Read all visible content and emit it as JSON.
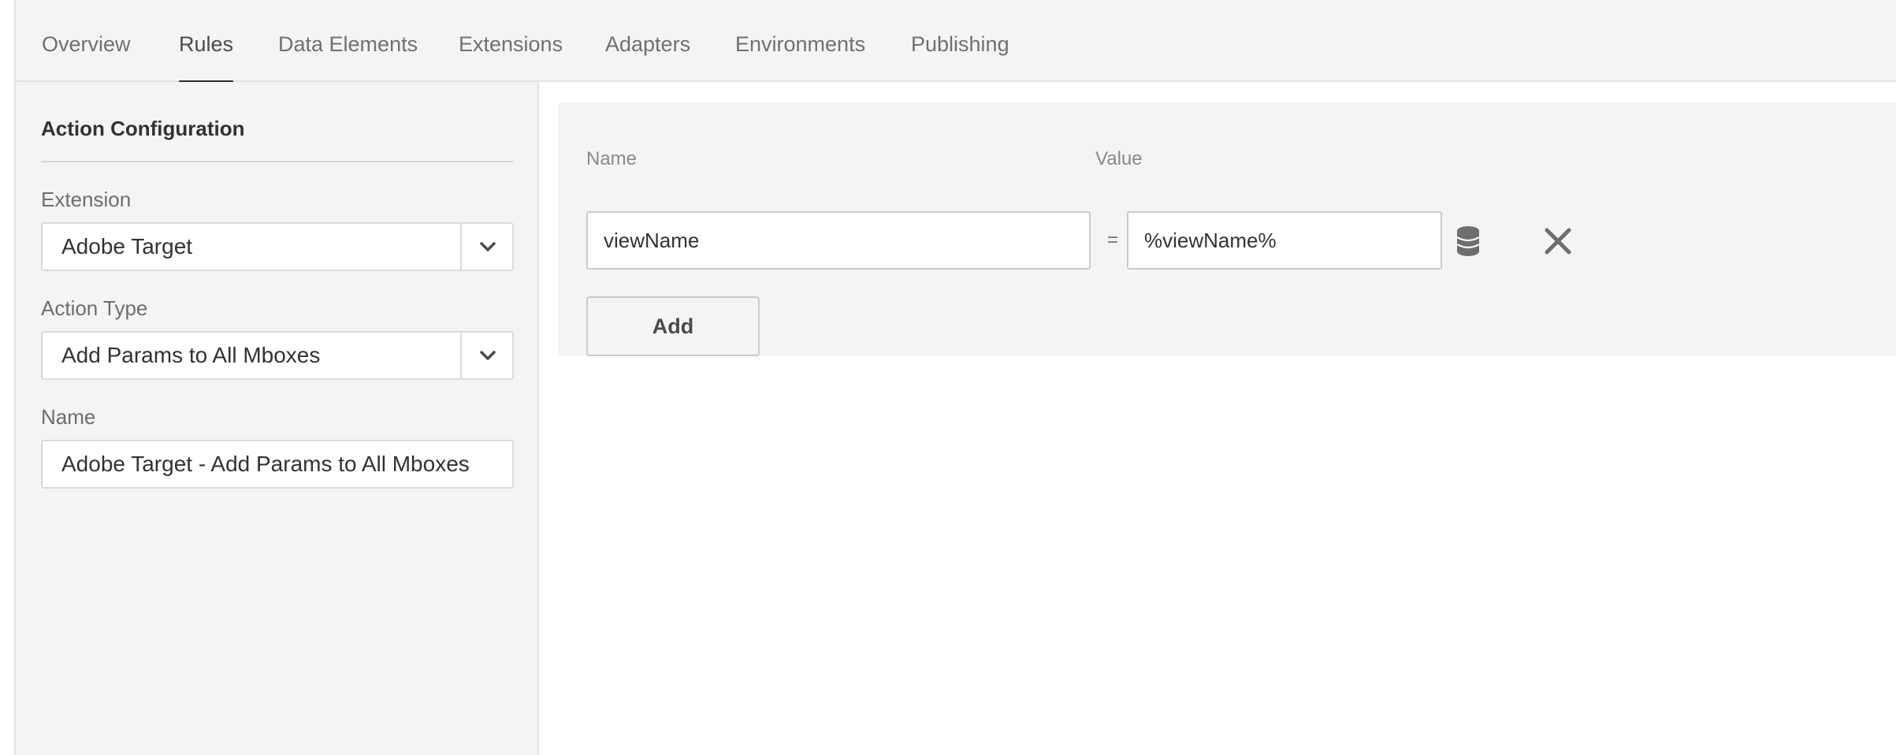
{
  "nav": {
    "tabs": [
      {
        "label": "Overview",
        "active": false
      },
      {
        "label": "Rules",
        "active": true
      },
      {
        "label": "Data Elements",
        "active": false
      },
      {
        "label": "Extensions",
        "active": false
      },
      {
        "label": "Adapters",
        "active": false
      },
      {
        "label": "Environments",
        "active": false
      },
      {
        "label": "Publishing",
        "active": false
      }
    ]
  },
  "sidebar": {
    "title": "Action Configuration",
    "extension": {
      "label": "Extension",
      "value": "Adobe Target"
    },
    "action_type": {
      "label": "Action Type",
      "value": "Add Params to All Mboxes"
    },
    "name": {
      "label": "Name",
      "value": "Adobe Target - Add Params to All Mboxes"
    }
  },
  "params": {
    "name_column_label": "Name",
    "value_column_label": "Value",
    "rows": [
      {
        "name": "viewName",
        "equals": "=",
        "value": "%viewName%"
      }
    ],
    "add_label": "Add"
  },
  "icons": {
    "dropdown": "chevron-down-icon",
    "data_element": "database-icon",
    "remove": "close-icon"
  },
  "colors": {
    "nav_background": "#f4f4f4",
    "active_tab_underline": "#323232",
    "panel_background": "#f4f4f4",
    "icon_gray": "#6e6e6e"
  }
}
